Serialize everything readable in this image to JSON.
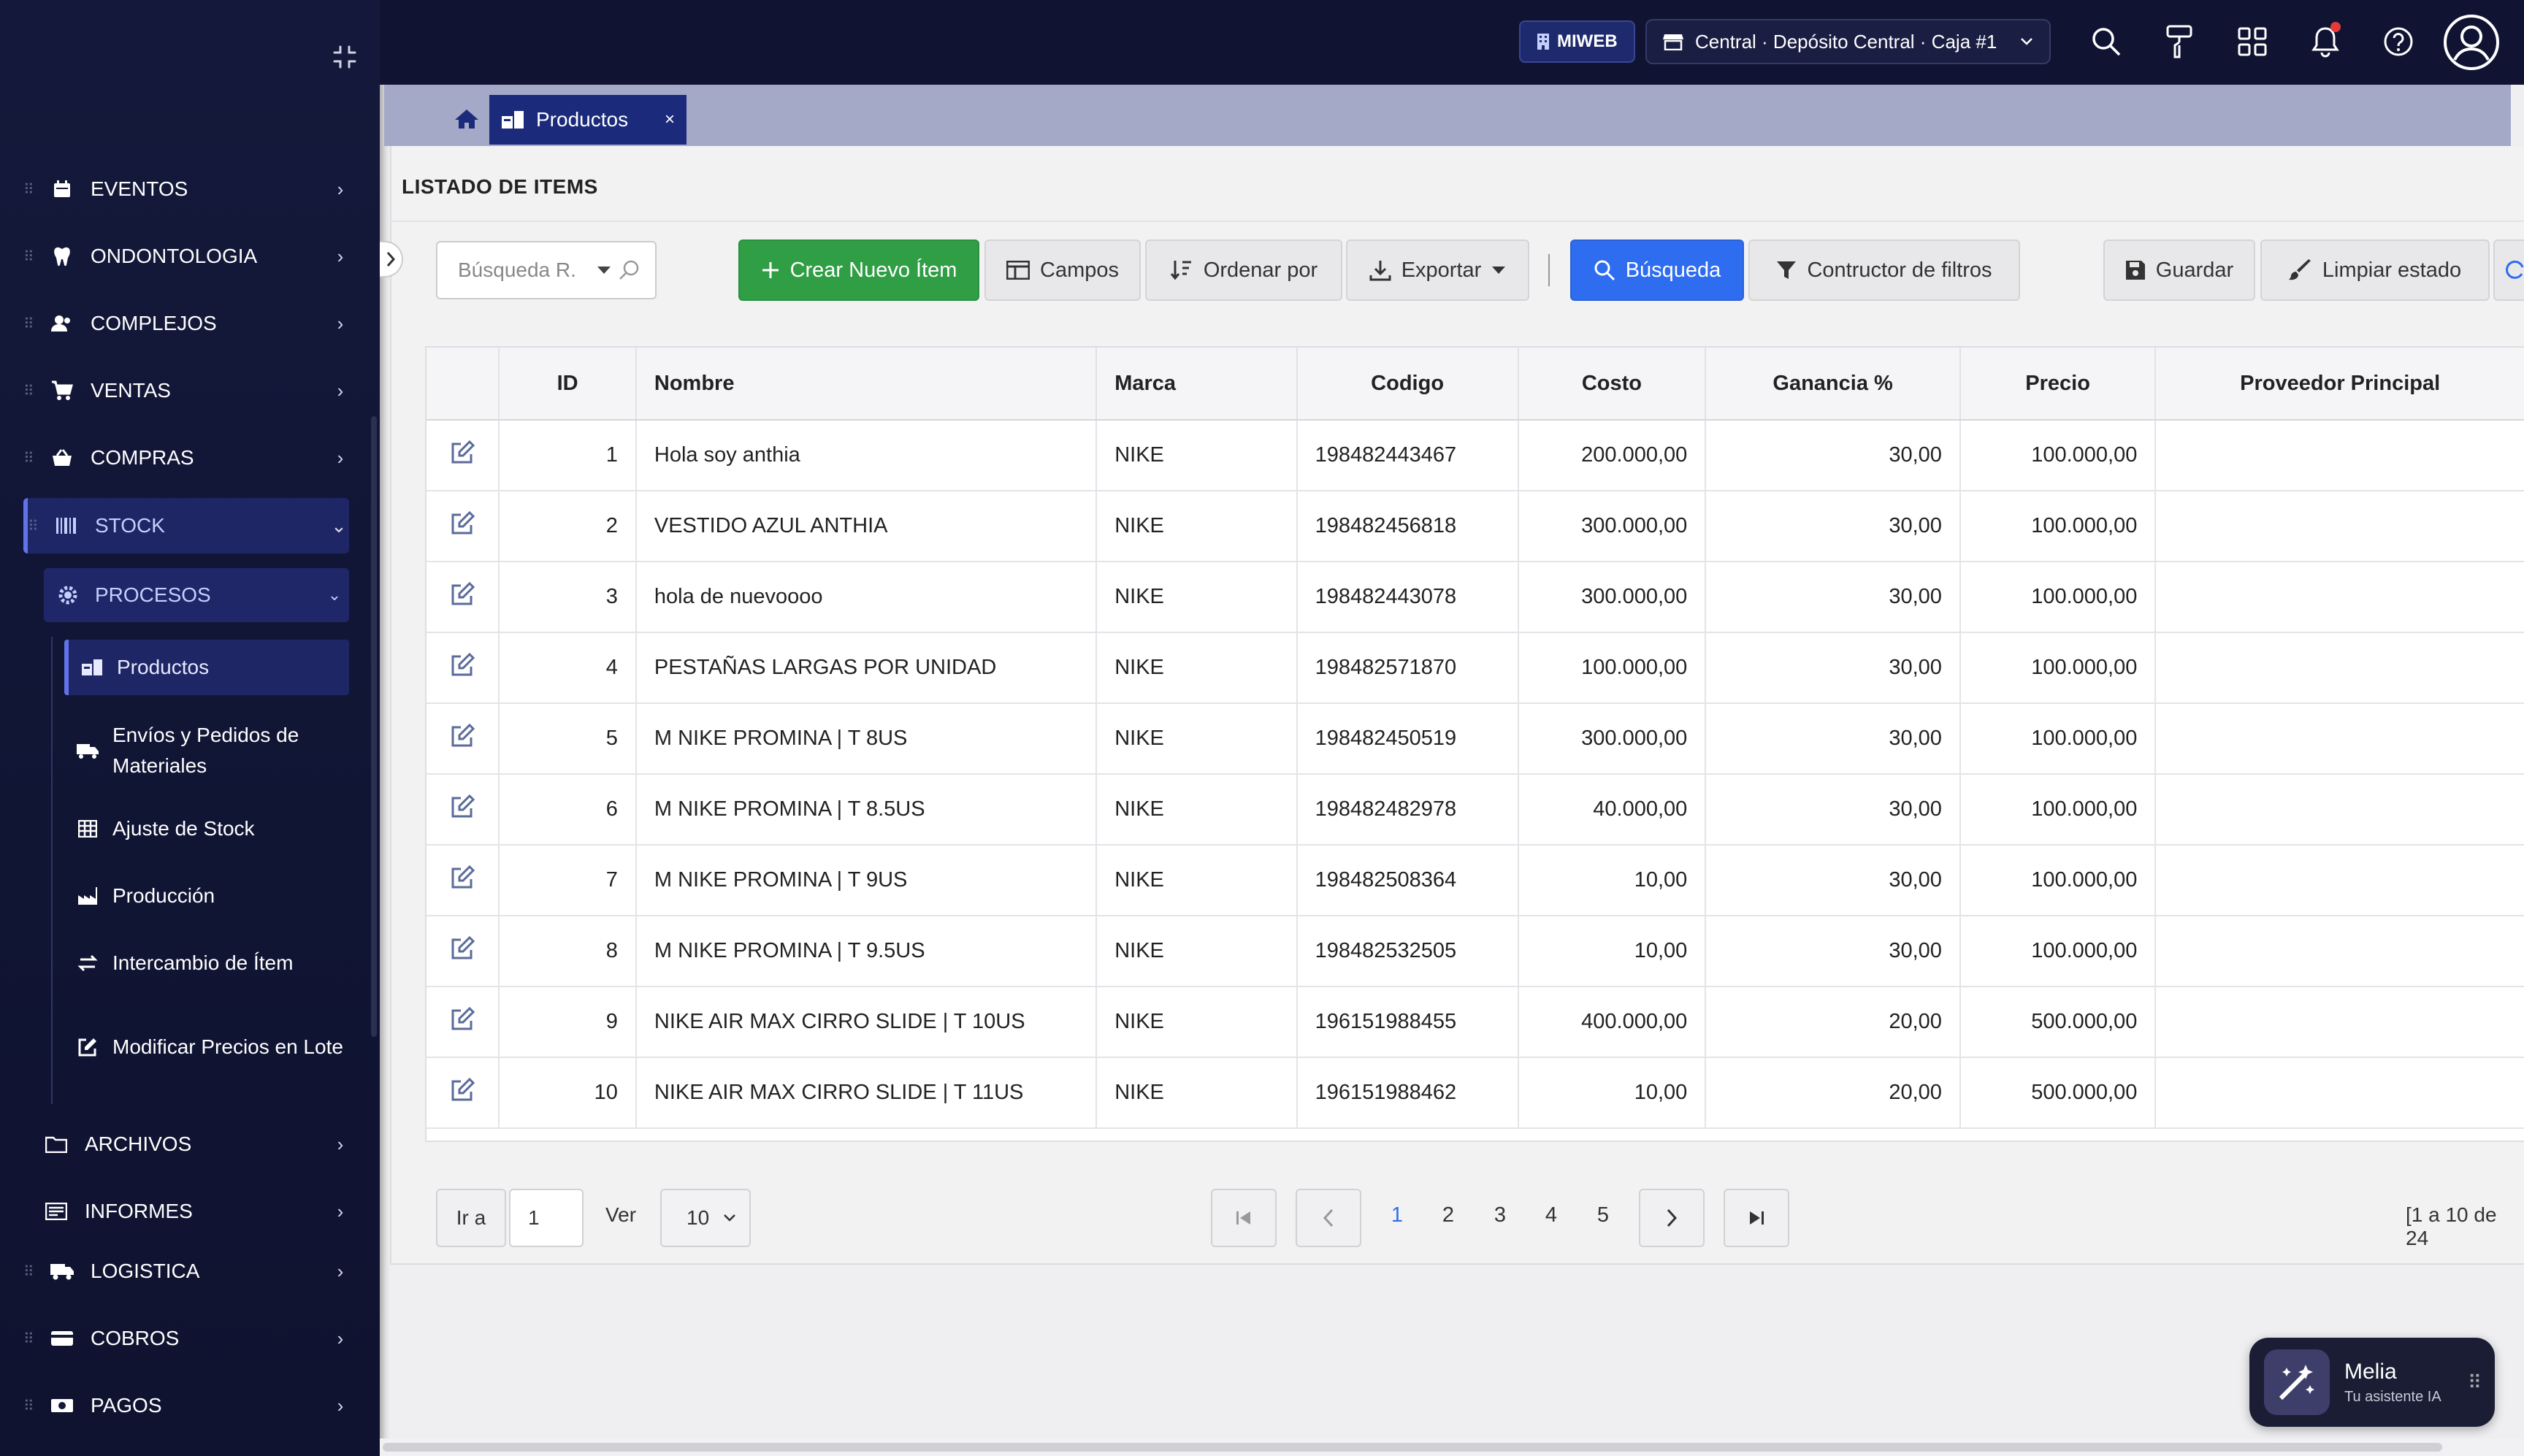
{
  "sidebar": {
    "items": [
      {
        "label": "EVENTOS",
        "icon": "calendar-icon"
      },
      {
        "label": "ONDONTOLOGIA",
        "icon": "tooth-icon"
      },
      {
        "label": "COMPLEJOS",
        "icon": "users-icon"
      },
      {
        "label": "VENTAS",
        "icon": "cart-icon"
      },
      {
        "label": "COMPRAS",
        "icon": "basket-icon"
      },
      {
        "label": "STOCK",
        "icon": "barcode-icon"
      },
      {
        "label": "PROCESOS",
        "icon": "gear-icon"
      },
      {
        "label": "ARCHIVOS",
        "icon": "folder-icon"
      },
      {
        "label": "INFORMES",
        "icon": "report-icon"
      },
      {
        "label": "LOGISTICA",
        "icon": "truck-icon"
      },
      {
        "label": "COBROS",
        "icon": "card-icon"
      },
      {
        "label": "PAGOS",
        "icon": "cash-icon"
      }
    ],
    "sub_items": [
      {
        "label": "Productos",
        "icon": "products-icon"
      },
      {
        "label": "Envíos y Pedidos de Materiales",
        "icon": "shipping-icon"
      },
      {
        "label": "Ajuste de Stock",
        "icon": "grid-icon"
      },
      {
        "label": "Producción",
        "icon": "factory-icon"
      },
      {
        "label": "Intercambio de Ítem",
        "icon": "swap-icon"
      },
      {
        "label": "Modificar Precios en Lote",
        "icon": "edit-icon"
      }
    ]
  },
  "topbar": {
    "badge": "MIWEB",
    "branch": "Central · Depósito Central · Caja #1"
  },
  "tabs": {
    "active": "Productos",
    "close": "×"
  },
  "page": {
    "title": "LISTADO DE ITEMS"
  },
  "toolbar": {
    "search_placeholder": "Búsqueda R.",
    "new_item": "Crear Nuevo Ítem",
    "fields": "Campos",
    "order_by": "Ordenar por",
    "export": "Exportar",
    "search": "Búsqueda",
    "filter_builder": "Contructor de filtros",
    "save": "Guardar",
    "clear_state": "Limpiar estado"
  },
  "table": {
    "headers": [
      "ID",
      "Nombre",
      "Marca",
      "Codigo",
      "Costo",
      "Ganancia %",
      "Precio",
      "Proveedor Principal"
    ],
    "rows": [
      {
        "id": "1",
        "nombre": "Hola soy anthia",
        "marca": "NIKE",
        "codigo": "198482443467",
        "costo": "200.000,00",
        "ganancia": "30,00",
        "precio": "100.000,00",
        "proveedor": ""
      },
      {
        "id": "2",
        "nombre": "VESTIDO AZUL ANTHIA",
        "marca": "NIKE",
        "codigo": "198482456818",
        "costo": "300.000,00",
        "ganancia": "30,00",
        "precio": "100.000,00",
        "proveedor": ""
      },
      {
        "id": "3",
        "nombre": "hola de nuevoooo",
        "marca": "NIKE",
        "codigo": "198482443078",
        "costo": "300.000,00",
        "ganancia": "30,00",
        "precio": "100.000,00",
        "proveedor": ""
      },
      {
        "id": "4",
        "nombre": "PESTAÑAS LARGAS POR UNIDAD",
        "marca": "NIKE",
        "codigo": "198482571870",
        "costo": "100.000,00",
        "ganancia": "30,00",
        "precio": "100.000,00",
        "proveedor": ""
      },
      {
        "id": "5",
        "nombre": "M NIKE PROMINA | T 8US",
        "marca": "NIKE",
        "codigo": "198482450519",
        "costo": "300.000,00",
        "ganancia": "30,00",
        "precio": "100.000,00",
        "proveedor": ""
      },
      {
        "id": "6",
        "nombre": "M NIKE PROMINA | T 8.5US",
        "marca": "NIKE",
        "codigo": "198482482978",
        "costo": "40.000,00",
        "ganancia": "30,00",
        "precio": "100.000,00",
        "proveedor": ""
      },
      {
        "id": "7",
        "nombre": "M NIKE PROMINA | T 9US",
        "marca": "NIKE",
        "codigo": "198482508364",
        "costo": "10,00",
        "ganancia": "30,00",
        "precio": "100.000,00",
        "proveedor": ""
      },
      {
        "id": "8",
        "nombre": "M NIKE PROMINA | T 9.5US",
        "marca": "NIKE",
        "codigo": "198482532505",
        "costo": "10,00",
        "ganancia": "30,00",
        "precio": "100.000,00",
        "proveedor": ""
      },
      {
        "id": "9",
        "nombre": "NIKE AIR MAX CIRRO SLIDE | T 10US",
        "marca": "NIKE",
        "codigo": "196151988455",
        "costo": "400.000,00",
        "ganancia": "20,00",
        "precio": "500.000,00",
        "proveedor": ""
      },
      {
        "id": "10",
        "nombre": "NIKE AIR MAX CIRRO SLIDE | T 11US",
        "marca": "NIKE",
        "codigo": "196151988462",
        "costo": "10,00",
        "ganancia": "20,00",
        "precio": "500.000,00",
        "proveedor": ""
      }
    ]
  },
  "pagination": {
    "goto_label": "Ir a",
    "goto_value": "1",
    "view_label": "Ver",
    "page_size": "10",
    "pages": [
      "1",
      "2",
      "3",
      "4",
      "5"
    ],
    "current_page": "1",
    "summary": "[1 a 10 de 24"
  },
  "assistant": {
    "name": "Melia",
    "subtitle": "Tu asistente IA"
  },
  "colors": {
    "sidebar_bg": "#14183a",
    "topbar_bg": "#101432",
    "active_tab": "#1b2a7a",
    "primary_blue": "#2e6cf0",
    "success_green": "#2f9e44",
    "accent_indigo": "#6073e8"
  }
}
